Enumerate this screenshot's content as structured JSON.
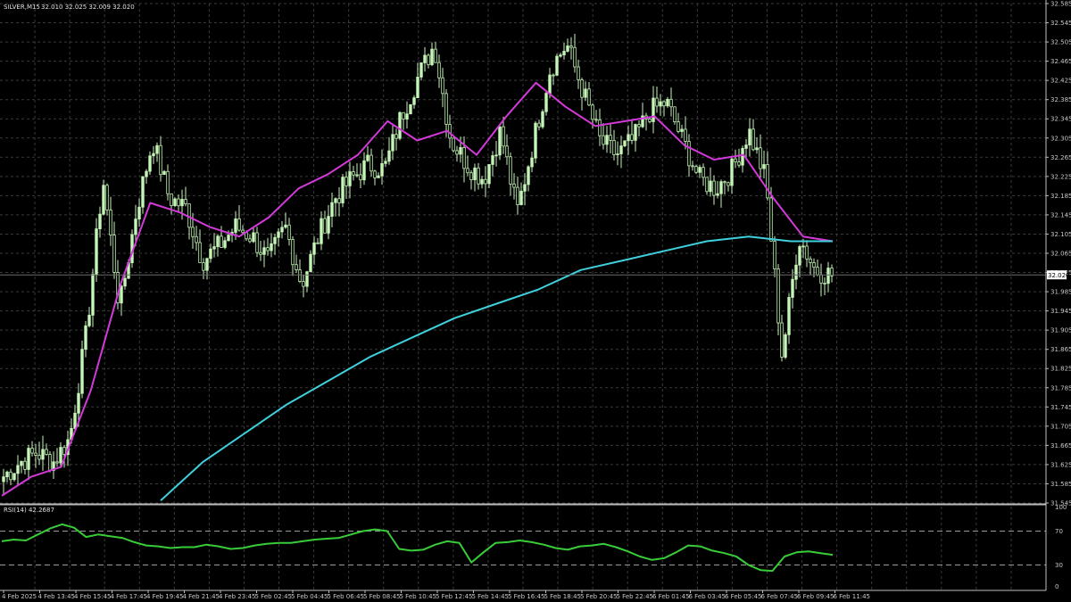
{
  "header": {
    "symbol": "SILVER,M15",
    "ohlc": "32.010 32.025 32.009 32.020"
  },
  "rsi_header": "RSI(14) 42.2687",
  "current_price_label": "32.020",
  "colors": {
    "background": "#000000",
    "grid": "#3a3a3a",
    "candle": "#c6f5b8",
    "ma_fast": "#d23ad8",
    "ma_slow": "#3fd0dc",
    "rsi": "#39cc39",
    "text": "#c8c8c8"
  },
  "chart_data": [
    {
      "type": "candlestick",
      "title": "SILVER,M15",
      "grid": true,
      "ylim": [
        31.545,
        32.585
      ],
      "y_ticks": [
        "32.585",
        "32.545",
        "32.505",
        "32.465",
        "32.425",
        "32.385",
        "32.345",
        "32.305",
        "32.265",
        "32.225",
        "32.185",
        "32.145",
        "32.105",
        "32.065",
        "32.025",
        "31.985",
        "31.945",
        "31.905",
        "31.865",
        "31.825",
        "31.785",
        "31.745",
        "31.705",
        "31.665",
        "31.625",
        "31.585",
        "31.545"
      ],
      "x_labels": [
        "4 Feb 2025",
        "4 Feb 13:45",
        "4 Feb 15:45",
        "4 Feb 17:45",
        "4 Feb 19:45",
        "4 Feb 21:45",
        "4 Feb 23:45",
        "5 Feb 02:45",
        "5 Feb 04:45",
        "5 Feb 06:45",
        "5 Feb 08:45",
        "5 Feb 10:45",
        "5 Feb 12:45",
        "5 Feb 14:45",
        "5 Feb 16:45",
        "5 Feb 18:45",
        "5 Feb 20:45",
        "5 Feb 22:45",
        "6 Feb 01:45",
        "6 Feb 03:45",
        "6 Feb 05:45",
        "6 Feb 07:45",
        "6 Feb 09:45",
        "6 Feb 11:45"
      ],
      "close_anchors": [
        31.6,
        31.63,
        31.65,
        31.63,
        31.68,
        31.9,
        32.22,
        31.95,
        32.15,
        32.3,
        32.18,
        32.16,
        32.05,
        32.08,
        32.12,
        32.1,
        32.05,
        32.12,
        32.0,
        32.1,
        32.18,
        32.22,
        32.25,
        32.24,
        32.35,
        32.43,
        32.5,
        32.3,
        32.25,
        32.22,
        32.32,
        32.15,
        32.3,
        32.45,
        32.5,
        32.4,
        32.3,
        32.27,
        32.3,
        32.36,
        32.38,
        32.3,
        32.22,
        32.2,
        32.24,
        32.32,
        32.22,
        31.85,
        32.1,
        32.03,
        32.02
      ],
      "series": [
        {
          "name": "",
          "kind": "moving-average",
          "values": [
            31.56,
            31.6,
            31.62,
            31.78,
            32.0,
            32.17,
            32.15,
            32.12,
            32.1,
            32.14,
            32.2,
            32.23,
            32.27,
            32.34,
            32.3,
            32.32,
            32.27,
            32.35,
            32.42,
            32.37,
            32.33,
            32.34,
            32.35,
            32.29,
            32.26,
            32.27,
            32.18,
            32.1,
            32.09
          ]
        },
        {
          "name": "",
          "kind": "moving-average",
          "values": [
            31.55,
            31.63,
            31.69,
            31.75,
            31.8,
            31.85,
            31.89,
            31.93,
            31.96,
            31.99,
            32.03,
            32.05,
            32.07,
            32.09,
            32.1,
            32.09,
            32.09
          ]
        }
      ]
    },
    {
      "type": "line",
      "title": "RSI(14) 42.2687",
      "ylim": [
        0,
        100
      ],
      "y_ticks": [
        100,
        70,
        30,
        0
      ],
      "levels": [
        70,
        30
      ],
      "series": [
        {
          "name": "",
          "values": [
            58,
            60,
            59,
            66,
            73,
            78,
            74,
            63,
            66,
            64,
            62,
            57,
            53,
            52,
            50,
            51,
            51,
            54,
            52,
            49,
            50,
            53,
            55,
            56,
            56,
            58,
            60,
            61,
            62,
            66,
            70,
            72,
            70,
            49,
            47,
            48,
            54,
            58,
            56,
            33,
            45,
            56,
            57,
            59,
            57,
            54,
            50,
            48,
            52,
            53,
            55,
            51,
            46,
            40,
            36,
            38,
            45,
            53,
            52,
            47,
            44,
            40,
            30,
            24,
            23,
            40,
            45,
            46,
            44,
            42
          ]
        }
      ]
    }
  ]
}
